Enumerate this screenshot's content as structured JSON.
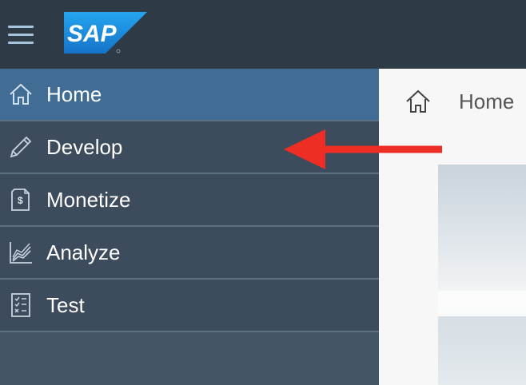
{
  "header": {
    "logo_text": "SAP",
    "colors": {
      "bar": "#2f3a47",
      "logo_blue": "#1f8ae0",
      "menu_icon": "#a8c4dc"
    }
  },
  "sidebar": {
    "items": [
      {
        "label": "Home",
        "icon": "home-icon",
        "active": true
      },
      {
        "label": "Develop",
        "icon": "pencil-icon",
        "active": false
      },
      {
        "label": "Monetize",
        "icon": "dollar-document-icon",
        "active": false
      },
      {
        "label": "Analyze",
        "icon": "chart-icon",
        "active": false
      },
      {
        "label": "Test",
        "icon": "checklist-icon",
        "active": false
      }
    ],
    "colors": {
      "active": "#416d94",
      "item": "#3d4c5c",
      "text": "#ffffff"
    }
  },
  "breadcrumb": {
    "label": "Home",
    "icon": "home-icon"
  },
  "annotation": {
    "type": "arrow",
    "color": "#ee2e24",
    "points_to": "Develop"
  }
}
